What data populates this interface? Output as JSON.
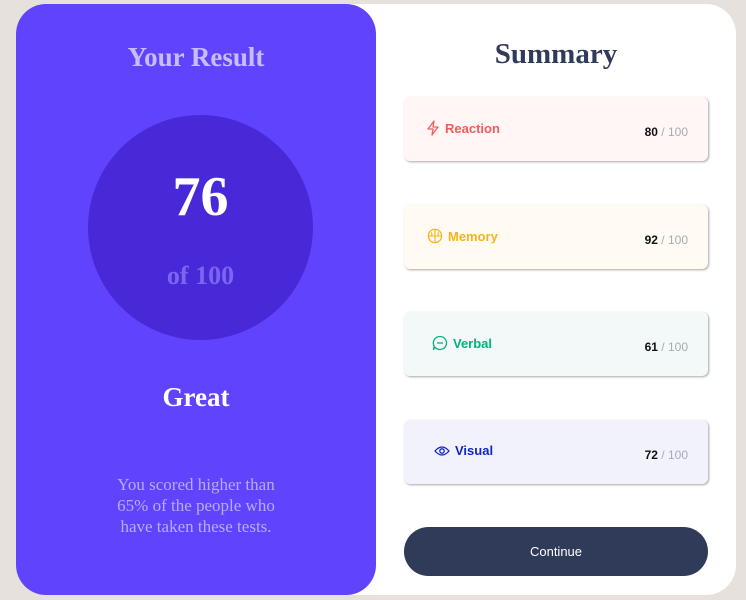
{
  "result": {
    "title": "Your Result",
    "score": "76",
    "score_of": "of 100",
    "rating": "Great",
    "description": "You scored higher than 65% of the people who have taken these tests."
  },
  "summary": {
    "title": "Summary",
    "items": [
      {
        "label": "Reaction",
        "score": "80",
        "max": " / 100",
        "icon": "lightning-icon",
        "color": "#f25c5c",
        "bg": "#fff6f5"
      },
      {
        "label": "Memory",
        "score": "92",
        "max": " / 100",
        "icon": "brain-icon",
        "color": "#f5b41c",
        "bg": "#fffbf3"
      },
      {
        "label": "Verbal",
        "score": "61",
        "max": " / 100",
        "icon": "chat-bubble-icon",
        "color": "#00b47b",
        "bg": "#f2f9f8"
      },
      {
        "label": "Visual",
        "score": "72",
        "max": " / 100",
        "icon": "eye-icon",
        "color": "#1225c5",
        "bg": "#f2f2fd"
      }
    ]
  },
  "continue_label": "Continue",
  "colors": {
    "result_bg": "#6043fd",
    "circle_bg": "#4929d7",
    "button_bg": "#303b59",
    "page_bg": "#e7e1de"
  }
}
